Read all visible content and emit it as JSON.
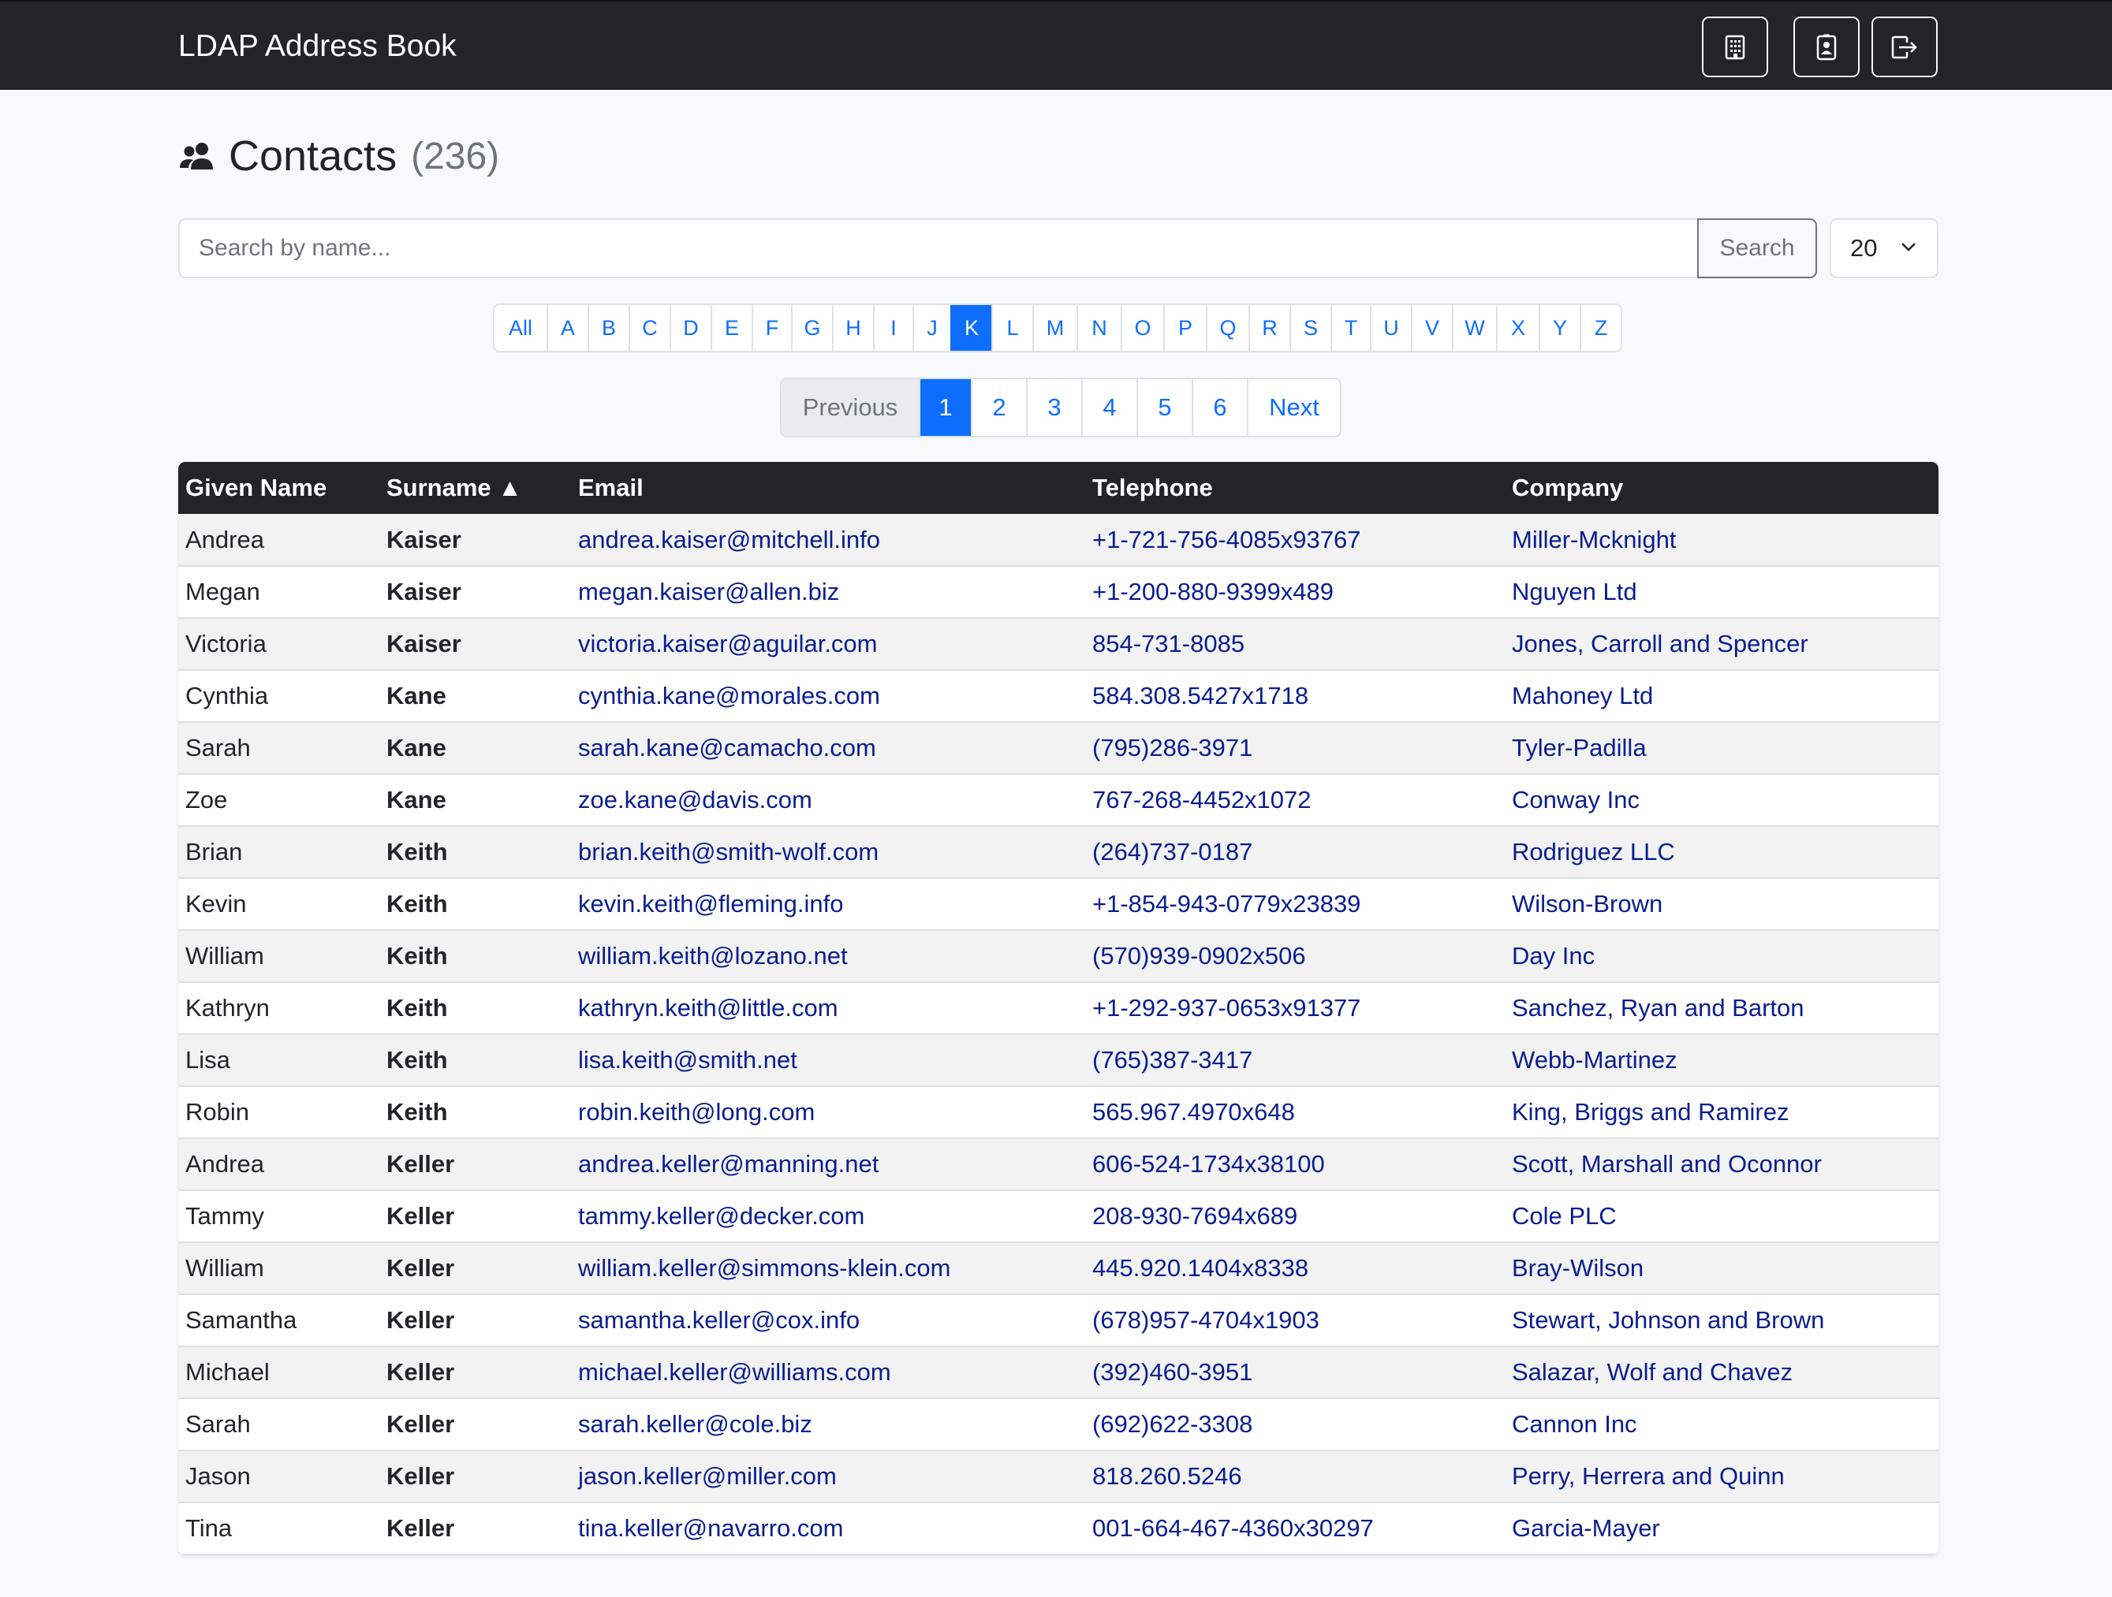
{
  "navbar": {
    "brand": "LDAP Address Book",
    "buttons": [
      {
        "icon": "building-icon"
      },
      {
        "icon": "contact-card-icon"
      },
      {
        "icon": "logout-icon"
      }
    ]
  },
  "header": {
    "icon": "people-icon",
    "title": "Contacts",
    "count": "(236)"
  },
  "search": {
    "placeholder": "Search by name...",
    "value": "",
    "button_label": "Search",
    "per_page": "20"
  },
  "letters": {
    "items": [
      "All",
      "A",
      "B",
      "C",
      "D",
      "E",
      "F",
      "G",
      "H",
      "I",
      "J",
      "K",
      "L",
      "M",
      "N",
      "O",
      "P",
      "Q",
      "R",
      "S",
      "T",
      "U",
      "V",
      "W",
      "X",
      "Y",
      "Z"
    ],
    "active": "K"
  },
  "pagination": {
    "previous": "Previous",
    "pages": [
      "1",
      "2",
      "3",
      "4",
      "5",
      "6"
    ],
    "active": "1",
    "next": "Next"
  },
  "table": {
    "columns": [
      "Given Name",
      "Surname ▲",
      "Email",
      "Telephone",
      "Company"
    ],
    "rows": [
      [
        "Andrea",
        "Kaiser",
        "andrea.kaiser@mitchell.info",
        "+1-721-756-4085x93767",
        "Miller-Mcknight"
      ],
      [
        "Megan",
        "Kaiser",
        "megan.kaiser@allen.biz",
        "+1-200-880-9399x489",
        "Nguyen Ltd"
      ],
      [
        "Victoria",
        "Kaiser",
        "victoria.kaiser@aguilar.com",
        "854-731-8085",
        "Jones, Carroll and Spencer"
      ],
      [
        "Cynthia",
        "Kane",
        "cynthia.kane@morales.com",
        "584.308.5427x1718",
        "Mahoney Ltd"
      ],
      [
        "Sarah",
        "Kane",
        "sarah.kane@camacho.com",
        "(795)286-3971",
        "Tyler-Padilla"
      ],
      [
        "Zoe",
        "Kane",
        "zoe.kane@davis.com",
        "767-268-4452x1072",
        "Conway Inc"
      ],
      [
        "Brian",
        "Keith",
        "brian.keith@smith-wolf.com",
        "(264)737-0187",
        "Rodriguez LLC"
      ],
      [
        "Kevin",
        "Keith",
        "kevin.keith@fleming.info",
        "+1-854-943-0779x23839",
        "Wilson-Brown"
      ],
      [
        "William",
        "Keith",
        "william.keith@lozano.net",
        "(570)939-0902x506",
        "Day Inc"
      ],
      [
        "Kathryn",
        "Keith",
        "kathryn.keith@little.com",
        "+1-292-937-0653x91377",
        "Sanchez, Ryan and Barton"
      ],
      [
        "Lisa",
        "Keith",
        "lisa.keith@smith.net",
        "(765)387-3417",
        "Webb-Martinez"
      ],
      [
        "Robin",
        "Keith",
        "robin.keith@long.com",
        "565.967.4970x648",
        "King, Briggs and Ramirez"
      ],
      [
        "Andrea",
        "Keller",
        "andrea.keller@manning.net",
        "606-524-1734x38100",
        "Scott, Marshall and Oconnor"
      ],
      [
        "Tammy",
        "Keller",
        "tammy.keller@decker.com",
        "208-930-7694x689",
        "Cole PLC"
      ],
      [
        "William",
        "Keller",
        "william.keller@simmons-klein.com",
        "445.920.1404x8338",
        "Bray-Wilson"
      ],
      [
        "Samantha",
        "Keller",
        "samantha.keller@cox.info",
        "(678)957-4704x1903",
        "Stewart, Johnson and Brown"
      ],
      [
        "Michael",
        "Keller",
        "michael.keller@williams.com",
        "(392)460-3951",
        "Salazar, Wolf and Chavez"
      ],
      [
        "Sarah",
        "Keller",
        "sarah.keller@cole.biz",
        "(692)622-3308",
        "Cannon Inc"
      ],
      [
        "Jason",
        "Keller",
        "jason.keller@miller.com",
        "818.260.5246",
        "Perry, Herrera and Quinn"
      ],
      [
        "Tina",
        "Keller",
        "tina.keller@navarro.com",
        "001-664-467-4360x30297",
        "Garcia-Mayer"
      ]
    ]
  },
  "colors": {
    "navbar": "#212529",
    "primary": "#0d6efd",
    "link": "#0a1d8f",
    "muted": "#6c757d"
  }
}
